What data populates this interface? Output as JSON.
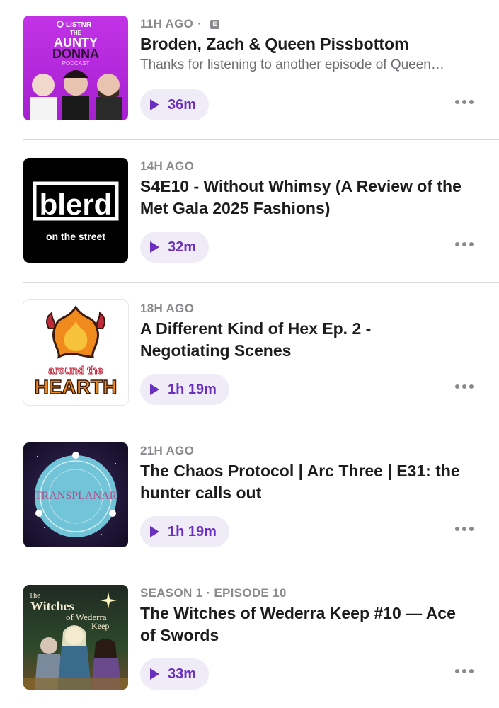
{
  "episodes": [
    {
      "meta": "11H AGO",
      "explicit": "E",
      "title": "Broden, Zach & Queen Pissbottom",
      "description": "Thanks for listening to another episode of Queen…",
      "duration": "36m",
      "artwork_icon": "aunty-donna-podcast-artwork",
      "art_text": [
        "LiSTNR",
        "THE",
        "AUNTY",
        "DONNA",
        "PODCAST"
      ]
    },
    {
      "meta": "14H AGO",
      "title_lines": [
        "S4E10 - Without Whimsy (A Review of the",
        "Met Gala 2025 Fashions)"
      ],
      "duration": "32m",
      "artwork_icon": "blerd-on-the-street-artwork",
      "art_text": [
        "blerd",
        "on the street"
      ]
    },
    {
      "meta": "18H AGO",
      "title_lines": [
        "A Different Kind of Hex Ep. 2 -",
        "Negotiating Scenes"
      ],
      "duration": "1h 19m",
      "artwork_icon": "around-the-hearth-artwork",
      "art_text": [
        "around the",
        "HEARTH"
      ]
    },
    {
      "meta": "21H AGO",
      "title_lines": [
        "The Chaos Protocol | Arc Three | E31: the",
        "hunter calls out"
      ],
      "duration": "1h 19m",
      "artwork_icon": "transplanar-artwork",
      "art_text": [
        "TRANSPLANAR"
      ]
    },
    {
      "meta": "SEASON 1 · EPISODE 10",
      "title_lines": [
        "The Witches of Wederra Keep #10 — Ace",
        "of Swords"
      ],
      "duration": "33m",
      "artwork_icon": "witches-of-wederra-keep-artwork",
      "art_text": [
        "The",
        "Witches",
        "of Wederra",
        "Keep"
      ]
    }
  ],
  "colors": {
    "accent": "#6b2fc0",
    "play_bg": "#efebf7",
    "meta": "#8a8a8e"
  }
}
